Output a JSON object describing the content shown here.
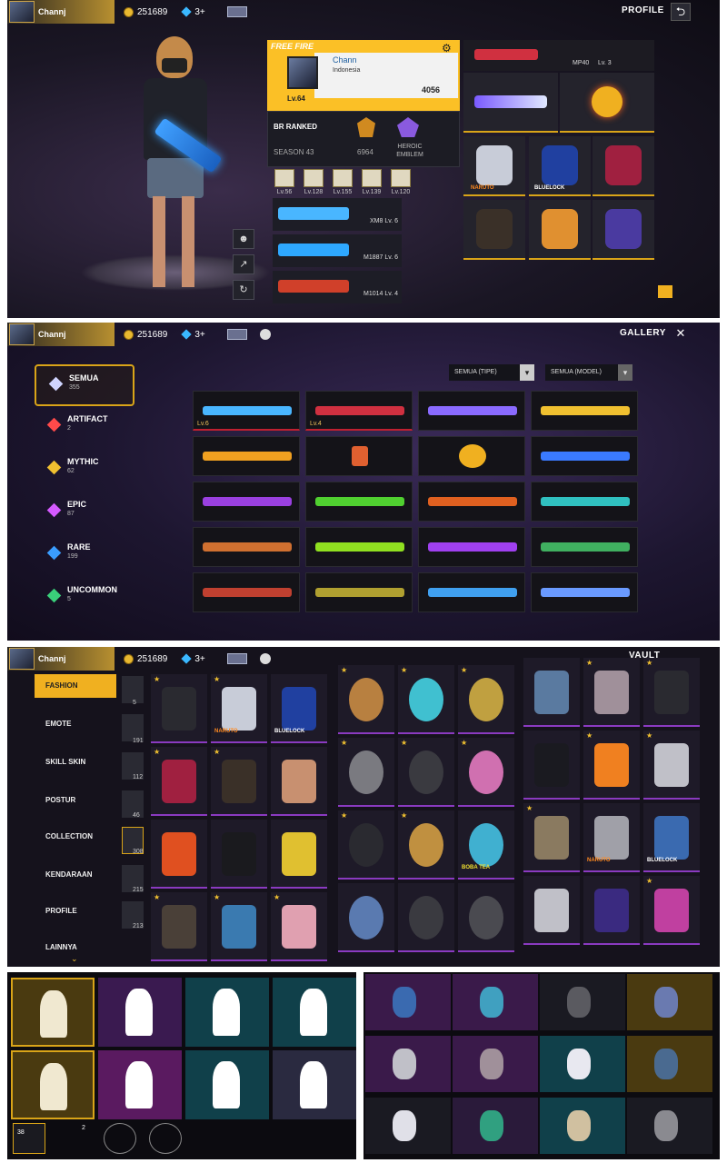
{
  "profile_screen": {
    "player_name": "Channj",
    "coins": "251689",
    "diamonds": "3+",
    "title": "PROFILE",
    "back_label": "⮌",
    "game_logo": "FREE FIRE",
    "card_name": "Chann",
    "region": "Indonesia",
    "level": "Lv.64",
    "likes": "4056",
    "br_ranked": "BR RANKED",
    "season": "SEASON 43",
    "rank_points": "6964",
    "heroic_emblem": "HEROIC EMBLEM",
    "skill_levels": [
      "Lv.56",
      "Lv.128",
      "Lv.155",
      "Lv.139",
      "Lv.120"
    ],
    "weapons": [
      {
        "name": "XM8",
        "level": "Lv. 6",
        "color": "#49b6ff"
      },
      {
        "name": "M1887",
        "level": "Lv. 6",
        "color": "#2ea8ff"
      },
      {
        "name": "M1014",
        "level": "Lv. 4",
        "color": "#d0402a"
      }
    ],
    "showcase_weapon": {
      "name": "MP40",
      "level": "Lv. 3"
    },
    "outfit_labels": [
      "NARUTO",
      "BLUELOCK"
    ]
  },
  "gallery_screen": {
    "player_name": "Channj",
    "coins": "251689",
    "diamonds": "3+",
    "title": "GALLERY",
    "close_label": "✕",
    "filter_type": "SEMUA (TIPE)",
    "filter_model": "SEMUA (MODEL)",
    "categories": [
      {
        "label": "SEMUA",
        "count": "355",
        "color": "#cfd4ff"
      },
      {
        "label": "ARTIFACT",
        "count": "2",
        "color": "#ff4a4a"
      },
      {
        "label": "MYTHIC",
        "count": "62",
        "color": "#f0c030"
      },
      {
        "label": "EPIC",
        "count": "87",
        "color": "#d45aff"
      },
      {
        "label": "RARE",
        "count": "199",
        "color": "#3a9dff"
      },
      {
        "label": "UNCOMMON",
        "count": "5",
        "color": "#3ad07a"
      }
    ],
    "grid_levels": [
      "Lv.6",
      "Lv.4"
    ]
  },
  "vault_screen": {
    "player_name": "Channj",
    "coins": "251689",
    "diamonds": "3+",
    "title": "VAULT",
    "categories": [
      {
        "label": "FASHION",
        "count": "5"
      },
      {
        "label": "EMOTE",
        "count": "191"
      },
      {
        "label": "SKILL SKIN",
        "count": "112"
      },
      {
        "label": "POSTUR",
        "count": "46"
      },
      {
        "label": "COLLECTION",
        "count": "308"
      },
      {
        "label": "KENDARAAN",
        "count": "215"
      },
      {
        "label": "PROFILE",
        "count": "213"
      },
      {
        "label": "LAINNYA",
        "count": ""
      }
    ],
    "item_labels": [
      "NARUTO",
      "BLUELOCK",
      "BOBA TEA"
    ]
  },
  "emote_screen": {
    "tray_count": "38",
    "tray_count_2": "2"
  },
  "icons": {
    "coin": "coin-icon",
    "diamond": "diamond-icon",
    "settings": "gear-icon",
    "back": "back-arrow-icon",
    "close": "close-icon"
  }
}
